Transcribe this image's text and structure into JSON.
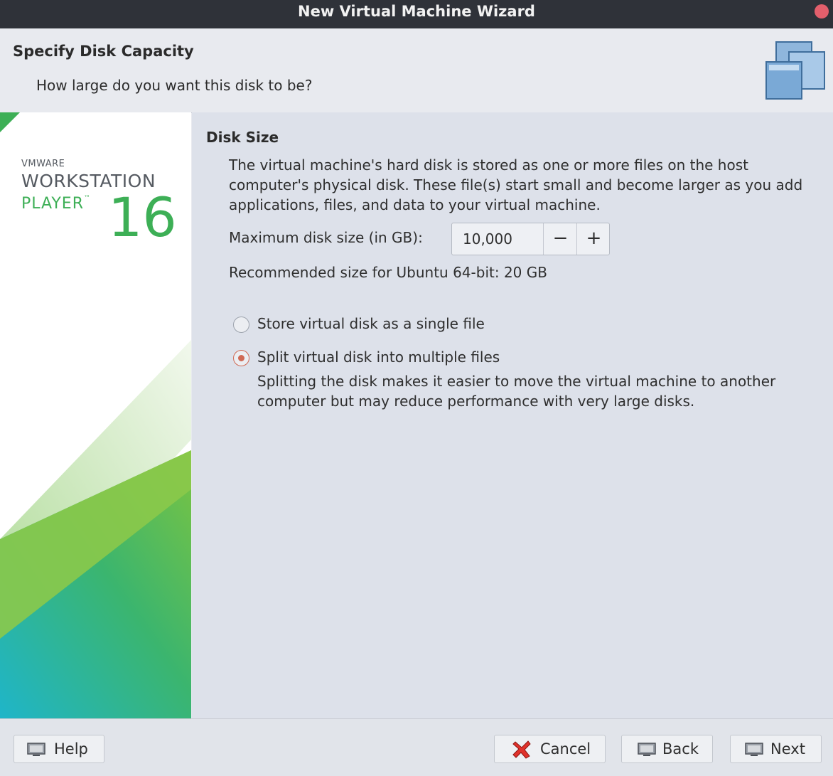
{
  "window": {
    "title": "New Virtual Machine Wizard"
  },
  "header": {
    "title": "Specify Disk Capacity",
    "subtitle": "How large do you want this disk to be?"
  },
  "branding": {
    "vendor": "VMWARE",
    "product": "WORKSTATION",
    "edition": "PLAYER",
    "trademark": "™",
    "version": "16"
  },
  "disk": {
    "section_title": "Disk Size",
    "description": "The virtual machine's hard disk is stored as one or more files on the host computer's physical disk. These file(s) start small and become larger as you add applications, files, and data to your virtual machine.",
    "max_size_label": "Maximum disk size (in GB):",
    "max_size_value": "10,000",
    "decrement_label": "−",
    "increment_label": "+",
    "recommended": "Recommended size for Ubuntu 64-bit: 20 GB"
  },
  "options": {
    "single_file_label": "Store virtual disk as a single file",
    "split_label": "Split virtual disk into multiple files",
    "split_hint": "Splitting the disk makes it easier to move the virtual machine to another computer but may reduce performance with very large disks.",
    "selected": "split"
  },
  "footer": {
    "help_label": "Help",
    "cancel_label": "Cancel",
    "back_label": "Back",
    "next_label": "Next"
  },
  "colors": {
    "titlebar": "#2f3239",
    "close_button": "#e35f6c",
    "brand_green": "#3daf56",
    "radio_accent": "#d06a55"
  }
}
